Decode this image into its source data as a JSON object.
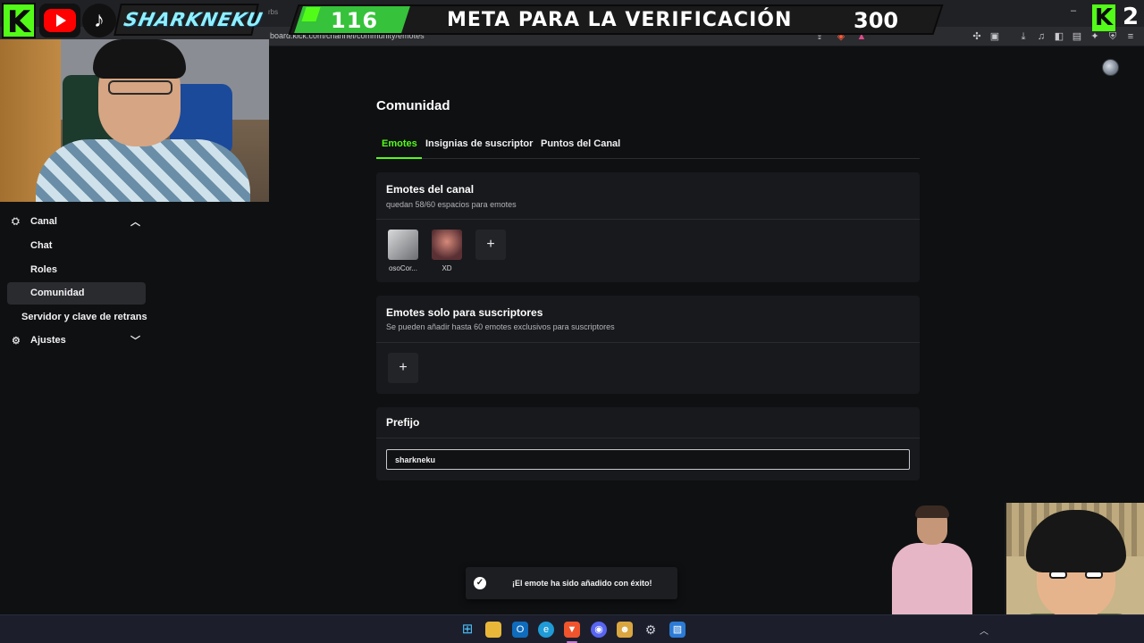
{
  "browser": {
    "url": "board.kick.com/channel/community/emotes",
    "tab_fragment": "rbs"
  },
  "overlay": {
    "goal_current": "116",
    "goal_text": "META PARA LA VERIFICACIÓN",
    "goal_target": "300",
    "brand_name": "SHARKNEKU",
    "corner_count": "2",
    "kick_letter": "K",
    "tiktok_glyph": "♪"
  },
  "sidebar": {
    "items": [
      {
        "label": "Canal",
        "icon": "channel-icon",
        "expanded": true
      },
      {
        "label": "Chat"
      },
      {
        "label": "Roles"
      },
      {
        "label": "Comunidad",
        "active": true
      },
      {
        "label": "Servidor y clave de retrans"
      },
      {
        "label": "Ajustes",
        "icon": "gear-icon",
        "expanded": false
      }
    ]
  },
  "page": {
    "title": "Comunidad",
    "tabs": [
      {
        "label": "Emotes",
        "active": true
      },
      {
        "label": "Insignias de suscriptor"
      },
      {
        "label": "Puntos del Canal"
      }
    ]
  },
  "channel_emotes": {
    "title": "Emotes del canal",
    "subtitle": "quedan 58/60 espacios para emotes",
    "emotes": [
      {
        "name": "osoCor..."
      },
      {
        "name": "XD"
      }
    ],
    "add_label": "+"
  },
  "sub_emotes": {
    "title": "Emotes solo para suscriptores",
    "subtitle": "Se pueden añadir hasta 60 emotes exclusivos para suscriptores",
    "add_label": "+"
  },
  "prefix": {
    "title": "Prefijo",
    "value": "sharkneku"
  },
  "toast": {
    "message": "¡El emote ha sido añadido con éxito!",
    "icon": "check-icon"
  },
  "colors": {
    "accent": "#53fc18",
    "background": "#0f1012",
    "card": "#18191c"
  }
}
